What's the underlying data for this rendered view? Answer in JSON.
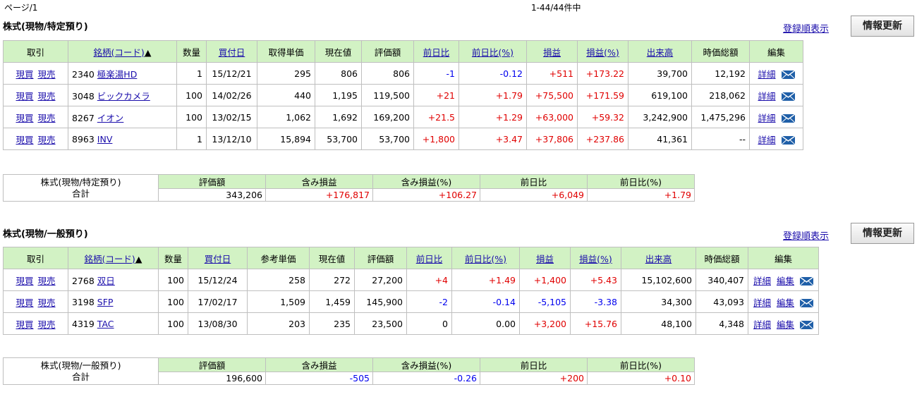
{
  "page_info": "ページ/1",
  "count_info": "1-44/44件中",
  "mail_icon_color": "#1f5fa8",
  "sections": [
    {
      "title": "株式(現物/特定預り)",
      "reg_link": "登録順表示",
      "update_button": "情報更新",
      "headers": {
        "trade": "取引",
        "name": "銘柄(コード)",
        "qty": "数量",
        "date": "買付日",
        "unit": "取得単価",
        "price": "現在値",
        "value": "評価額",
        "chg": "前日比",
        "chgpct": "前日比(%)",
        "pl": "損益",
        "plpct": "損益(%)",
        "vol": "出来高",
        "mcap": "時価総額",
        "edit": "編集"
      },
      "sort_mark": "▲",
      "rows": [
        {
          "buy": "現買",
          "sell": "現売",
          "code": "2340",
          "name": "極楽湯HD",
          "qty": "1",
          "date": "15/12/21",
          "unit": "295",
          "price": "806",
          "value": "806",
          "chg": "-1",
          "chgpct": "-0.12",
          "pl": "+511",
          "plpct": "+173.22",
          "vol": "39,700",
          "mcap": "12,192",
          "detail": "詳細",
          "edit": ""
        },
        {
          "buy": "現買",
          "sell": "現売",
          "code": "3048",
          "name": "ビックカメラ",
          "qty": "100",
          "date": "14/02/26",
          "unit": "440",
          "price": "1,195",
          "value": "119,500",
          "chg": "+21",
          "chgpct": "+1.79",
          "pl": "+75,500",
          "plpct": "+171.59",
          "vol": "619,100",
          "mcap": "218,062",
          "detail": "詳細",
          "edit": ""
        },
        {
          "buy": "現買",
          "sell": "現売",
          "code": "8267",
          "name": "イオン",
          "qty": "100",
          "date": "13/02/15",
          "unit": "1,062",
          "price": "1,692",
          "value": "169,200",
          "chg": "+21.5",
          "chgpct": "+1.29",
          "pl": "+63,000",
          "plpct": "+59.32",
          "vol": "3,242,900",
          "mcap": "1,475,296",
          "detail": "詳細",
          "edit": ""
        },
        {
          "buy": "現買",
          "sell": "現売",
          "code": "8963",
          "name": "INV",
          "qty": "1",
          "date": "13/12/10",
          "unit": "15,894",
          "price": "53,700",
          "value": "53,700",
          "chg": "+1,800",
          "chgpct": "+3.47",
          "pl": "+37,806",
          "plpct": "+237.86",
          "vol": "41,361",
          "mcap": "--",
          "detail": "詳細",
          "edit": ""
        }
      ],
      "summary": {
        "label1": "株式(現物/特定預り)",
        "label2": "合計",
        "h_value": "評価額",
        "h_pl": "含み損益",
        "h_plpct": "含み損益(%)",
        "h_chg": "前日比",
        "h_chgpct": "前日比(%)",
        "value": "343,206",
        "pl": "+176,817",
        "plpct": "+106.27",
        "chg": "+6,049",
        "chgpct": "+1.79"
      }
    },
    {
      "title": "株式(現物/一般預り)",
      "reg_link": "登録順表示",
      "update_button": "情報更新",
      "headers": {
        "trade": "取引",
        "name": "銘柄(コード)",
        "qty": "数量",
        "date": "買付日",
        "unit": "参考単価",
        "price": "現在値",
        "value": "評価額",
        "chg": "前日比",
        "chgpct": "前日比(%)",
        "pl": "損益",
        "plpct": "損益(%)",
        "vol": "出来高",
        "mcap": "時価総額",
        "edit": "編集"
      },
      "sort_mark": "▲",
      "rows": [
        {
          "buy": "現買",
          "sell": "現売",
          "code": "2768",
          "name": "双日",
          "qty": "100",
          "date": "15/12/24",
          "unit": "258",
          "price": "272",
          "value": "27,200",
          "chg": "+4",
          "chgpct": "+1.49",
          "pl": "+1,400",
          "plpct": "+5.43",
          "vol": "15,102,600",
          "mcap": "340,407",
          "detail": "詳細",
          "edit": "編集"
        },
        {
          "buy": "現買",
          "sell": "現売",
          "code": "3198",
          "name": "SFP",
          "qty": "100",
          "date": "17/02/17",
          "unit": "1,509",
          "price": "1,459",
          "value": "145,900",
          "chg": "-2",
          "chgpct": "-0.14",
          "pl": "-5,105",
          "plpct": "-3.38",
          "vol": "34,300",
          "mcap": "43,093",
          "detail": "詳細",
          "edit": "編集"
        },
        {
          "buy": "現買",
          "sell": "現売",
          "code": "4319",
          "name": "TAC",
          "qty": "100",
          "date": "13/08/30",
          "unit": "203",
          "price": "235",
          "value": "23,500",
          "chg": "0",
          "chgpct": "0.00",
          "pl": "+3,200",
          "plpct": "+15.76",
          "vol": "48,100",
          "mcap": "4,348",
          "detail": "詳細",
          "edit": "編集"
        }
      ],
      "summary": {
        "label1": "株式(現物/一般預り)",
        "label2": "合計",
        "h_value": "評価額",
        "h_pl": "含み損益",
        "h_plpct": "含み損益(%)",
        "h_chg": "前日比",
        "h_chgpct": "前日比(%)",
        "value": "196,600",
        "pl": "-505",
        "plpct": "-0.26",
        "chg": "+200",
        "chgpct": "+0.10"
      }
    }
  ]
}
